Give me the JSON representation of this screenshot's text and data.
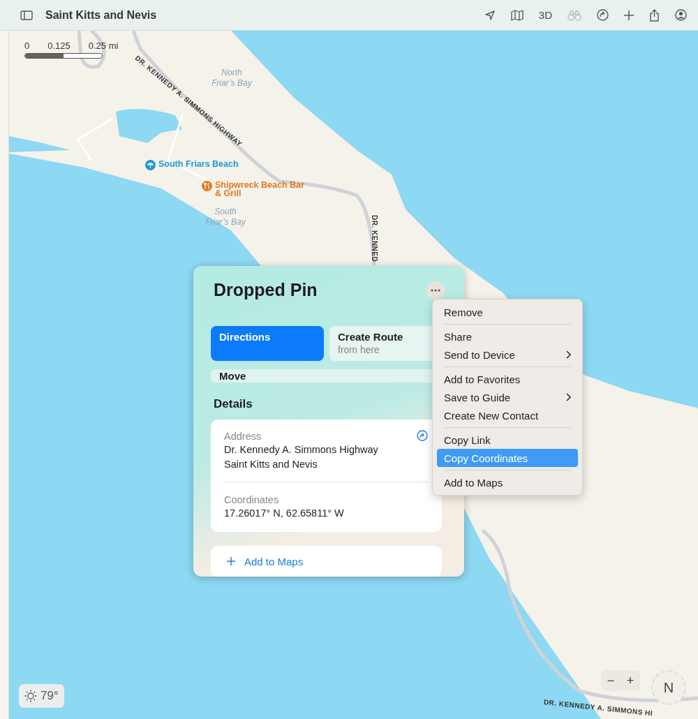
{
  "toolbar": {
    "title": "Saint Kitts and Nevis",
    "view_3d_label": "3D",
    "look_around_disabled": true
  },
  "map": {
    "scale_labels": [
      "0",
      "0.125",
      "0.25 mi"
    ],
    "labels": [
      {
        "text": "North Friar’s Bay",
        "kind": "water"
      },
      {
        "text": "DR. KENNEDY A. SIMMONS HIGHWAY",
        "kind": "road"
      },
      {
        "text": "South Friars Beach",
        "kind": "beach",
        "color": "#1a9ad6"
      },
      {
        "text": "Shipwreck Beach Bar & Grill",
        "kind": "food",
        "color": "#e07a1f"
      },
      {
        "text": "South Friar’s Bay",
        "kind": "water"
      },
      {
        "text": "DR. KENNED",
        "kind": "road"
      },
      {
        "text": "DR. KENNEDY A. SIMMONS HI",
        "kind": "road"
      }
    ],
    "weather": "79°",
    "zoom_out": "−",
    "zoom_in": "+",
    "compass": "N"
  },
  "card": {
    "title": "Dropped Pin",
    "actions": [
      {
        "label": "Directions",
        "kind": "primary"
      },
      {
        "label": "Create Route",
        "sublabel": "from here",
        "kind": "secondary"
      }
    ],
    "move": "Move",
    "details_heading": "Details",
    "address_label": "Address",
    "address_lines": [
      "Dr. Kennedy A. Simmons Highway",
      "Saint Kitts and Nevis"
    ],
    "coordinates_label": "Coordinates",
    "coordinates": "17.26017° N, 62.65811° W",
    "add_to_maps": "Add to Maps"
  },
  "menu": {
    "groups": [
      [
        {
          "label": "Remove",
          "submenu": false,
          "selected": false
        }
      ],
      [
        {
          "label": "Share",
          "submenu": false,
          "selected": false
        },
        {
          "label": "Send to Device",
          "submenu": true,
          "selected": false
        }
      ],
      [
        {
          "label": "Add to Favorites",
          "submenu": false,
          "selected": false
        },
        {
          "label": "Save to Guide",
          "submenu": true,
          "selected": false
        },
        {
          "label": "Create New Contact",
          "submenu": false,
          "selected": false
        }
      ],
      [
        {
          "label": "Copy Link",
          "submenu": false,
          "selected": false
        },
        {
          "label": "Copy Coordinates",
          "submenu": false,
          "selected": true
        }
      ],
      [
        {
          "label": "Add to Maps",
          "submenu": false,
          "selected": false
        }
      ]
    ]
  }
}
